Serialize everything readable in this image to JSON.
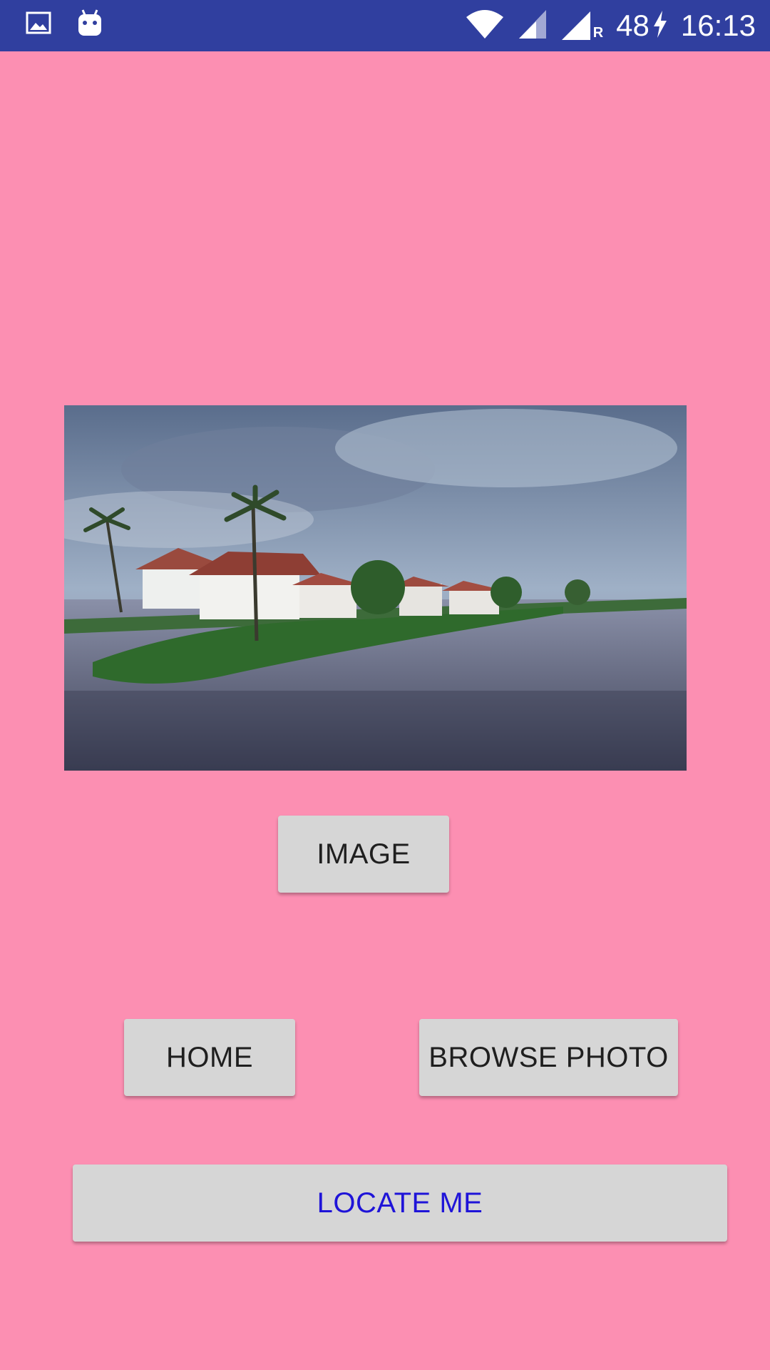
{
  "status_bar": {
    "battery_level": "48",
    "time": "16:13",
    "icons": [
      "gallery-icon",
      "android-icon",
      "wifi-icon",
      "signal-icon",
      "signal-roaming-icon",
      "charging-icon"
    ],
    "roaming_label": "R"
  },
  "photo": {
    "subject": "lakeside houses with palm trees under cloudy sky"
  },
  "buttons": {
    "image": "IMAGE",
    "home": "HOME",
    "browse_photo": "BROWSE PHOTO",
    "locate_me": "LOCATE ME"
  },
  "colors": {
    "background": "#fc8fb2",
    "status_bar": "#303f9f",
    "button": "#d6d6d6",
    "locate_text": "#1f14d8"
  }
}
